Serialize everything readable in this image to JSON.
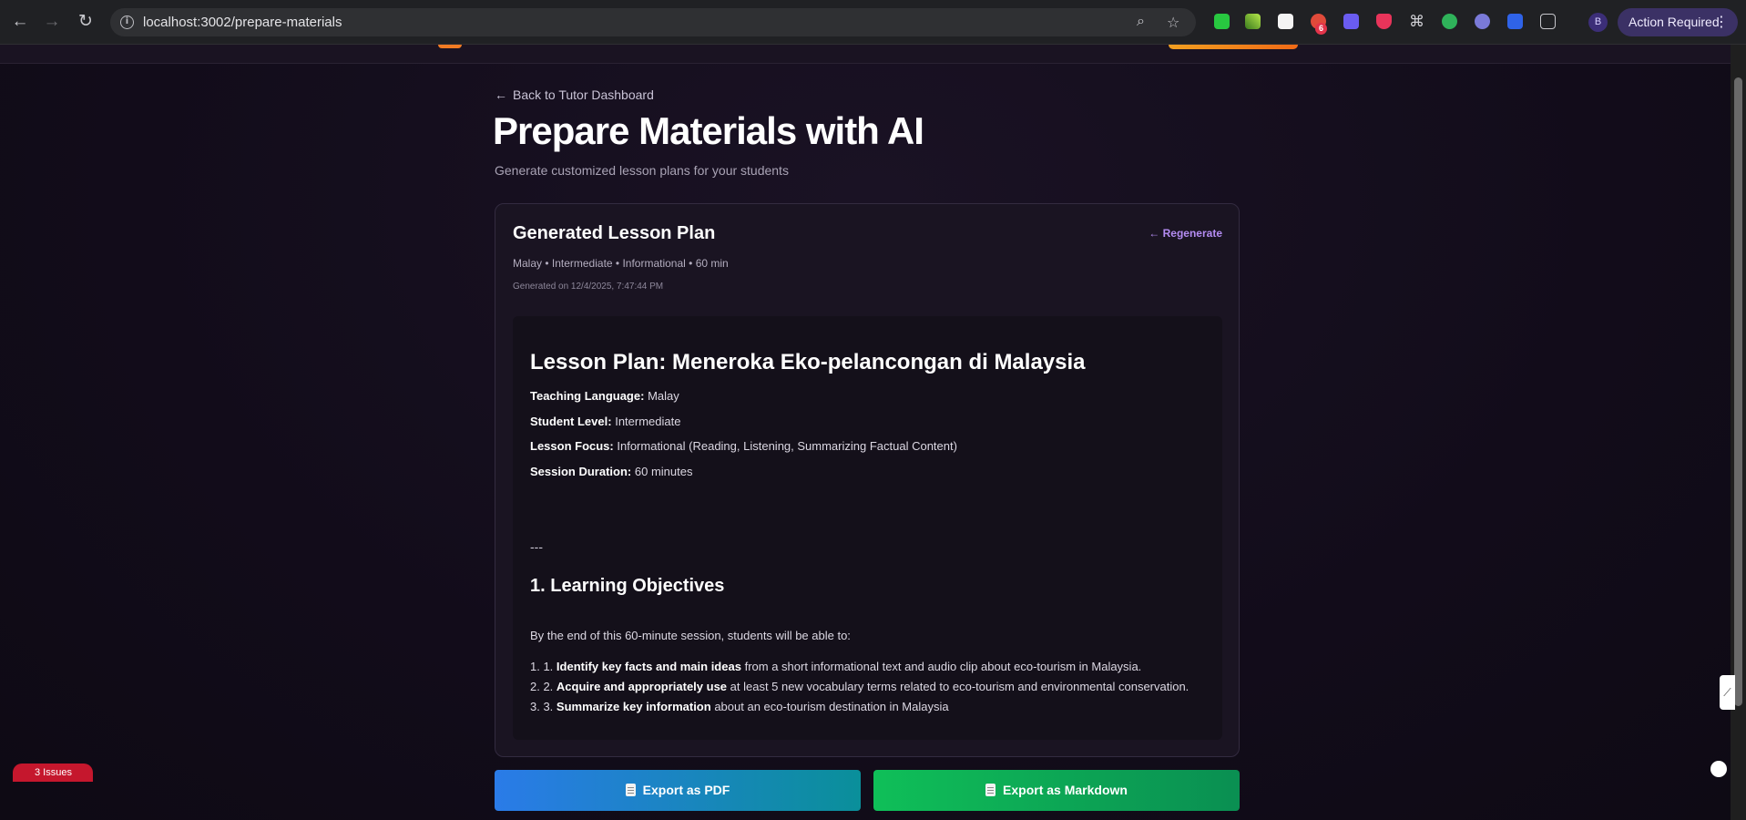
{
  "browser": {
    "url": "localhost:3002/prepare-materials",
    "extension_badge_count": "6",
    "profile_initial": "B",
    "action_required_label": "Action Required"
  },
  "page": {
    "back_link": "Back to Tutor Dashboard",
    "title": "Prepare Materials with AI",
    "subtitle": "Generate customized lesson plans for your students"
  },
  "card": {
    "title": "Generated Lesson Plan",
    "regenerate_label": "Regenerate",
    "meta": "Malay • Intermediate • Informational • 60 min",
    "generated_on": "Generated on 12/4/2025, 7:47:44 PM"
  },
  "lesson": {
    "title": "Lesson Plan: Meneroka Eko-pelancongan di Malaysia",
    "fields": [
      {
        "label": "Teaching Language:",
        "value": "Malay"
      },
      {
        "label": "Student Level:",
        "value": "Intermediate"
      },
      {
        "label": "Lesson Focus:",
        "value": "Informational (Reading, Listening, Summarizing Factual Content)"
      },
      {
        "label": "Session Duration:",
        "value": "60 minutes"
      }
    ],
    "separator": "---",
    "section_heading": "1. Learning Objectives",
    "intro": "By the end of this 60-minute session, students will be able to:",
    "objectives": [
      {
        "num": "1. 1.",
        "bold": "Identify key facts and main ideas",
        "rest": "from a short informational text and audio clip about eco-tourism in Malaysia."
      },
      {
        "num": "2. 2.",
        "bold": "Acquire and appropriately use",
        "rest": "at least 5 new vocabulary terms related to eco-tourism and environmental conservation."
      },
      {
        "num": "3. 3.",
        "bold": "Summarize key information",
        "rest": "about an eco-tourism destination in Malaysia"
      }
    ]
  },
  "actions": {
    "export_pdf": "Export as PDF",
    "export_markdown": "Export as Markdown"
  },
  "dev": {
    "issues_label": "3 Issues"
  }
}
